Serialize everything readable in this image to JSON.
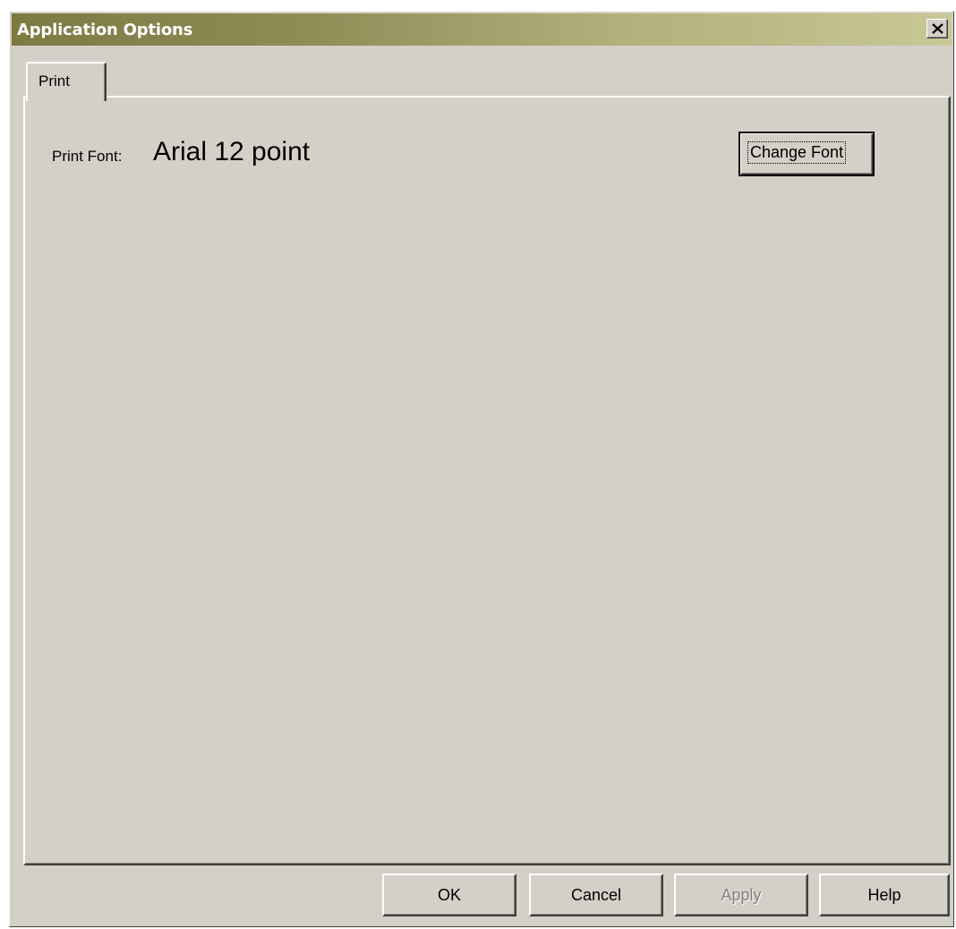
{
  "window": {
    "title": "Application Options"
  },
  "tabs": [
    {
      "label": "Print",
      "selected": true
    }
  ],
  "print_tab": {
    "print_font_label": "Print Font:",
    "print_font_value": "Arial 12 point",
    "change_font_button": "Change Font"
  },
  "buttons": {
    "ok": "OK",
    "cancel": "Cancel",
    "apply": "Apply",
    "help": "Help"
  },
  "state": {
    "apply_enabled": false
  },
  "colors": {
    "dialog_face": "#d4d0c8",
    "title_gradient_start": "#7d7a42",
    "title_gradient_end": "#c8c896",
    "title_text": "#ffffff"
  },
  "icons": {
    "close": "close-icon"
  }
}
